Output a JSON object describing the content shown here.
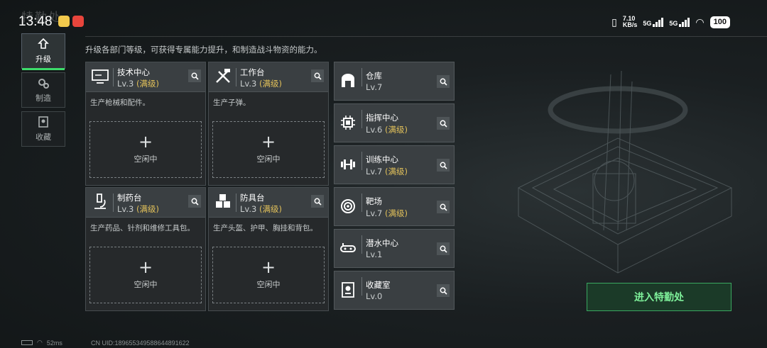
{
  "status_bar": {
    "time": "13:48",
    "net_speed": "7.10",
    "net_unit": "KB/s",
    "sim1": "5G",
    "sim2": "5G",
    "battery": "100"
  },
  "game_title": "特勤处",
  "nav": [
    {
      "label": "升级",
      "icon": "upgrade-icon",
      "active": true
    },
    {
      "label": "制造",
      "icon": "gears-icon",
      "active": false
    },
    {
      "label": "收藏",
      "icon": "collection-icon",
      "active": false
    }
  ],
  "description": "升级各部门等级，可获得专属能力提升，和制造战斗物资的能力。",
  "cards": [
    {
      "name": "技术中心",
      "level": "Lv.3",
      "max": "(满级)",
      "text": "生产枪械和配件。",
      "slot_plus": "+",
      "slot_label": "空闲中",
      "icon": "monitor-icon"
    },
    {
      "name": "工作台",
      "level": "Lv.3",
      "max": "(满级)",
      "text": "生产子弹。",
      "slot_plus": "+",
      "slot_label": "空闲中",
      "icon": "tools-icon"
    },
    {
      "name": "制药台",
      "level": "Lv.3",
      "max": "(满级)",
      "text": "生产药品、针剂和维修工具包。",
      "slot_plus": "+",
      "slot_label": "空闲中",
      "icon": "microscope-icon"
    },
    {
      "name": "防具台",
      "level": "Lv.3",
      "max": "(满级)",
      "text": "生产头盔、护甲、胸挂和背包。",
      "slot_plus": "+",
      "slot_label": "空闲中",
      "icon": "cubes-icon"
    }
  ],
  "rows": [
    {
      "name": "仓库",
      "level": "Lv.7",
      "max": "",
      "icon": "warehouse-icon"
    },
    {
      "name": "指挥中心",
      "level": "Lv.6",
      "max": "(满级)",
      "icon": "chip-icon"
    },
    {
      "name": "训练中心",
      "level": "Lv.7",
      "max": "(满级)",
      "icon": "dumbbell-icon"
    },
    {
      "name": "靶场",
      "level": "Lv.7",
      "max": "(满级)",
      "icon": "target-icon"
    },
    {
      "name": "潜水中心",
      "level": "Lv.1",
      "max": "",
      "icon": "diving-icon"
    },
    {
      "name": "收藏室",
      "level": "Lv.0",
      "max": "",
      "icon": "trophy-icon"
    }
  ],
  "enter_button": "进入特勤处",
  "footer": {
    "ping": "52ms",
    "uid": "CN UID:18965534958864489162​2"
  },
  "colors": {
    "accent_green": "#3ddc6a",
    "max_gold": "#e2c15a"
  }
}
